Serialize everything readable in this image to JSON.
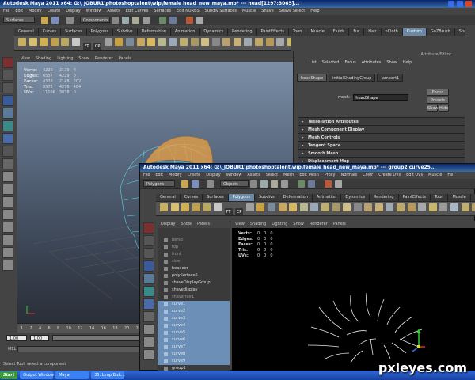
{
  "back_window": {
    "title": "Autodesk Maya 2011 x64: G:\\_JOBUR1\\photoshoptalent\\wip\\female head_new_maya.mb*   ---   head[1297:3065]...",
    "menus": [
      "File",
      "Edit",
      "Modify",
      "Create",
      "Display",
      "Window",
      "Assets",
      "Edit Curves",
      "Surfaces",
      "Edit NURBS",
      "Subdiv Surfaces",
      "Muscle",
      "Shave",
      "Shave Select",
      "Help"
    ],
    "mode": "Surfaces",
    "components_label": "Components",
    "shelf_tabs": [
      "General",
      "Curves",
      "Surfaces",
      "Polygons",
      "Subdivs",
      "Deformation",
      "Animation",
      "Dynamics",
      "Rendering",
      "PaintEffects",
      "Toon",
      "Muscle",
      "Fluids",
      "Fur",
      "Hair",
      "nCloth",
      "Custom",
      "GoZBrush",
      "Shave"
    ],
    "active_tab": "Custom",
    "shelf_text": [
      "FT",
      "CP"
    ],
    "panel_menus": [
      "View",
      "Shading",
      "Lighting",
      "Show",
      "Renderer",
      "Panels"
    ],
    "hud": [
      {
        "label": "Verts:",
        "a": "4220",
        "b": "2179",
        "c": "0"
      },
      {
        "label": "Edges:",
        "a": "6557",
        "b": "4229",
        "c": "0"
      },
      {
        "label": "Faces:",
        "a": "4328",
        "b": "2148",
        "c": "202"
      },
      {
        "label": "Tris:",
        "a": "8372",
        "b": "4276",
        "c": "404"
      },
      {
        "label": "UVs:",
        "a": "11106",
        "b": "3838",
        "c": "0"
      }
    ],
    "time_ticks": [
      "1",
      "2",
      "4",
      "6",
      "8",
      "10",
      "12",
      "14",
      "16",
      "18",
      "20",
      "22"
    ],
    "range_start": "1.00",
    "range_inner": "1.00",
    "mel_label": "MEL",
    "help_line": "Select Tool: select a component"
  },
  "attr_editor": {
    "title": "Attribute Editor",
    "menus": [
      "List",
      "Selected",
      "Focus",
      "Attributes",
      "Show",
      "Help"
    ],
    "tabs": [
      "headShape",
      "initialShadingGroup",
      "lambert1"
    ],
    "mesh_label": "mesh:",
    "mesh_value": "headShape",
    "focus_btn": "Focus",
    "presets_btn": "Presets",
    "show_btn": "Show",
    "hide_btn": "Hide",
    "sections": [
      "Tessellation Attributes",
      "Mesh Component Display",
      "Mesh Controls",
      "Tangent Space",
      "Smooth Mesh",
      "Displacement Map"
    ]
  },
  "front_window": {
    "title": "Autodesk Maya 2011 x64: G:\\_JOBUR1\\photoshoptalent\\wip\\female head_new_maya.mb*   ---   group2|curve25...",
    "menus": [
      "File",
      "Edit",
      "Modify",
      "Create",
      "Display",
      "Window",
      "Assets",
      "Select",
      "Mesh",
      "Edit Mesh",
      "Proxy",
      "Normals",
      "Color",
      "Create UVs",
      "Edit UVs",
      "Muscle",
      "He"
    ],
    "mode": "Polygons",
    "objects_label": "Objects",
    "shelf_tabs": [
      "General",
      "Curves",
      "Surfaces",
      "Polygons",
      "Subdivs",
      "Deformation",
      "Animation",
      "Dynamics",
      "Rendering",
      "PaintEffects",
      "Toon",
      "Muscle",
      "Fluid"
    ],
    "active_tab": "Polygons",
    "shelf_text": [
      "FT",
      "CP"
    ],
    "outliner_menus": [
      "Display",
      "Show",
      "Panels"
    ],
    "outliner": [
      {
        "label": "persp",
        "state": "dim"
      },
      {
        "label": "top",
        "state": "dim"
      },
      {
        "label": "front",
        "state": "dim"
      },
      {
        "label": "side",
        "state": "dim"
      },
      {
        "label": "headeer",
        "state": "normal"
      },
      {
        "label": "polySurface5",
        "state": "normal"
      },
      {
        "label": "shaveDisplayGroup",
        "state": "normal"
      },
      {
        "label": "shavedisplay",
        "state": "normal"
      },
      {
        "label": "shaveHair1",
        "state": "dim"
      },
      {
        "label": "curve1",
        "state": "sel"
      },
      {
        "label": "curve2",
        "state": "sel"
      },
      {
        "label": "curve3",
        "state": "sel"
      },
      {
        "label": "curve4",
        "state": "sel"
      },
      {
        "label": "curve5",
        "state": "sel"
      },
      {
        "label": "curve6",
        "state": "sel"
      },
      {
        "label": "curve7",
        "state": "sel"
      },
      {
        "label": "curve8",
        "state": "sel"
      },
      {
        "label": "curve9",
        "state": "sel"
      },
      {
        "label": "group1",
        "state": "normal"
      }
    ],
    "panel_menus": [
      "View",
      "Shading",
      "Lighting",
      "Show",
      "Renderer",
      "Panels"
    ],
    "hud": [
      {
        "label": "Verts:",
        "a": "0",
        "b": "0",
        "c": "0"
      },
      {
        "label": "Edges:",
        "a": "0",
        "b": "0",
        "c": "0"
      },
      {
        "label": "Faces:",
        "a": "0",
        "b": "0",
        "c": "0"
      },
      {
        "label": "Tris:",
        "a": "0",
        "b": "0",
        "c": "0"
      },
      {
        "label": "UVs:",
        "a": "0",
        "b": "0",
        "c": "0"
      }
    ]
  },
  "taskbar": {
    "start": "Start",
    "items": [
      "Output Window",
      "Maya",
      "35. Limp Bizk..."
    ]
  },
  "watermark": "pxleyes.com",
  "colors": {
    "accent": "#6a8aa8",
    "selection": "#6b8fb6",
    "title_blue": "#0a246a",
    "mesh_cyan": "#5fd6e6",
    "head_orange": "#d89a4a"
  }
}
